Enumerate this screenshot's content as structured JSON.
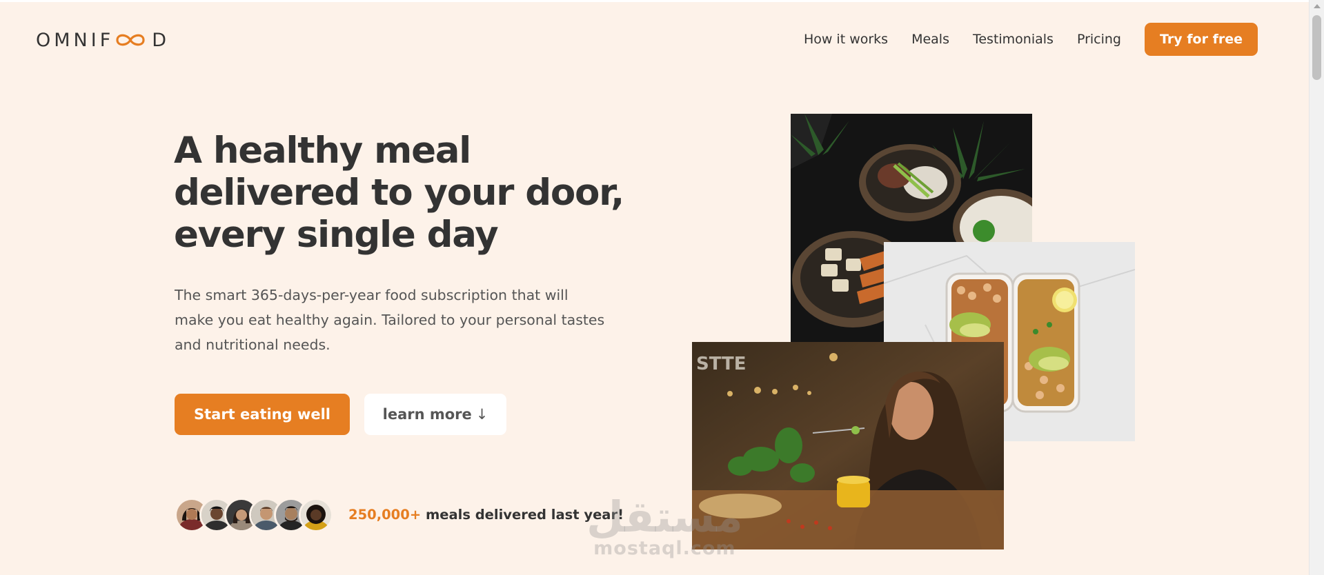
{
  "brand": {
    "name_left": "OMNIF",
    "name_right": "D",
    "accent": "#e67e22",
    "background": "#fdf2e9",
    "text": "#333333"
  },
  "nav": {
    "items": [
      {
        "label": "How it works"
      },
      {
        "label": "Meals"
      },
      {
        "label": "Testimonials"
      },
      {
        "label": "Pricing"
      }
    ],
    "cta": "Try for free"
  },
  "hero": {
    "title_lines": [
      "A healthy meal",
      "delivered to your door,",
      "every single day"
    ],
    "description_lines": [
      "The smart 365-days-per-year food subscription that will",
      "make you eat healthy again. Tailored to your personal tastes",
      "and nutritional needs."
    ],
    "primary_button": "Start eating well",
    "secondary_button": "learn more",
    "secondary_arrow": "↓"
  },
  "social_proof": {
    "count": "250,000+",
    "text": " meals delivered last year!"
  },
  "watermark": {
    "arabic": "مستقل",
    "latin": "mostaql.com"
  }
}
